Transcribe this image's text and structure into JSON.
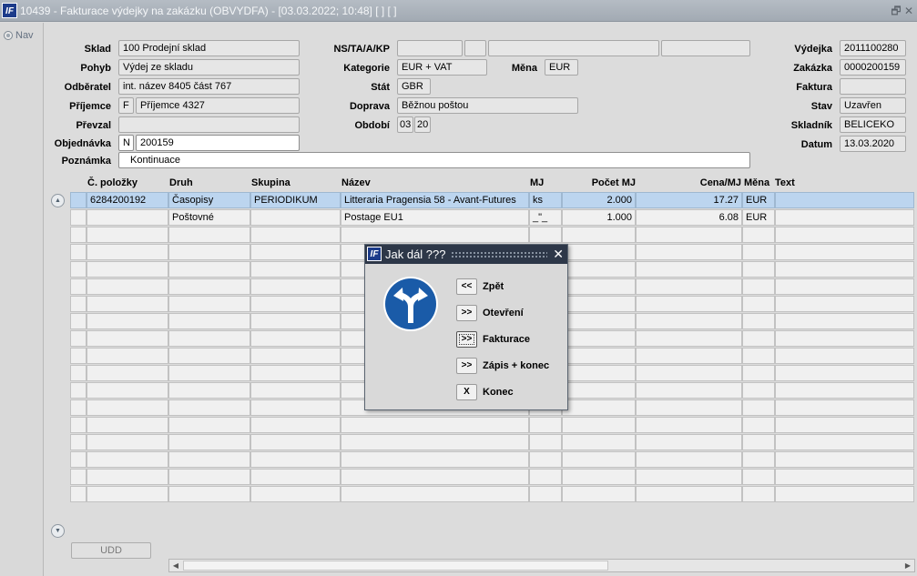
{
  "window": {
    "title": "10439 - Fakturace výdejky na zakázku (OBVYDFA) - [03.03.2022; 10:48]  [ ]  [ ]",
    "logo_text": "IF",
    "restore_glyph": "🗗",
    "close_glyph": "✕"
  },
  "nav": {
    "label": "Nav"
  },
  "form": {
    "sklad": {
      "label": "Sklad",
      "value": "100 Prodejní sklad"
    },
    "pohyb": {
      "label": "Pohyb",
      "value": "Výdej ze skladu"
    },
    "odberatel": {
      "label": "Odběratel",
      "value": "int. název 8405 část 767"
    },
    "prijemce": {
      "label": "Příjemce",
      "flag": "F",
      "value": "Příjemce 4327"
    },
    "prevzal": {
      "label": "Převzal",
      "value": ""
    },
    "objednavka": {
      "label": "Objednávka",
      "flag": "N",
      "value": "200159"
    },
    "poznamka": {
      "label": "Poznámka",
      "value": "Kontinuace"
    },
    "nstaakp": {
      "label": "NS/TA/A/KP",
      "values": [
        "",
        "",
        "",
        ""
      ]
    },
    "kategorie": {
      "label": "Kategorie",
      "value": "EUR + VAT"
    },
    "mena": {
      "label": "Měna",
      "value": "EUR"
    },
    "stat": {
      "label": "Stát",
      "value": "GBR"
    },
    "doprava": {
      "label": "Doprava",
      "value": "Běžnou poštou"
    },
    "obdobi": {
      "label": "Období",
      "month": "03",
      "year": "20"
    },
    "vydejka": {
      "label": "Výdejka",
      "value": "2011100280"
    },
    "zakazka": {
      "label": "Zakázka",
      "value": "0000200159"
    },
    "faktura": {
      "label": "Faktura",
      "value": ""
    },
    "stav": {
      "label": "Stav",
      "value": "Uzavřen"
    },
    "skladnik": {
      "label": "Skladník",
      "value": "BELICEKO"
    },
    "datum": {
      "label": "Datum",
      "value": "13.03.2020"
    }
  },
  "table": {
    "headers": {
      "polozky": "Č. položky",
      "druh": "Druh",
      "skupina": "Skupina",
      "nazev": "Název",
      "mj": "MJ",
      "pocet": "Počet MJ",
      "cena": "Cena/MJ",
      "mena": "Měna",
      "text": "Text"
    },
    "rows": [
      {
        "polozka": "6284200192",
        "druh": "Časopisy",
        "skupina": "PERIODIKUM",
        "nazev": "Litteraria Pragensia 58 - Avant-Futures",
        "mj": "ks",
        "pocet": "2.000",
        "cena": "17.27",
        "mena": "EUR",
        "text": ""
      },
      {
        "polozka": "",
        "druh": "Poštovné",
        "skupina": "",
        "nazev": "Postage EU1",
        "mj": "_\"_",
        "pocet": "1.000",
        "cena": "6.08",
        "mena": "EUR",
        "text": ""
      }
    ],
    "empty_rows": 16
  },
  "udd_button": "UDD",
  "dialog": {
    "title": "Jak dál ???",
    "logo_text": "IF",
    "close_glyph": "✕",
    "buttons": [
      {
        "glyph": "<<",
        "label": "Zpět"
      },
      {
        "glyph": ">>",
        "label": "Otevření"
      },
      {
        "glyph": ">>",
        "label": "Fakturace"
      },
      {
        "glyph": ">>",
        "label": "Zápis + konec"
      },
      {
        "glyph": "X",
        "label": "Konec"
      }
    ],
    "icon": "fork-left-right-arrow-sign"
  },
  "colors": {
    "selected_row": "#bcd5ef",
    "dialog_title_bg": "#2d3748",
    "sign_blue": "#1a5ba8"
  }
}
